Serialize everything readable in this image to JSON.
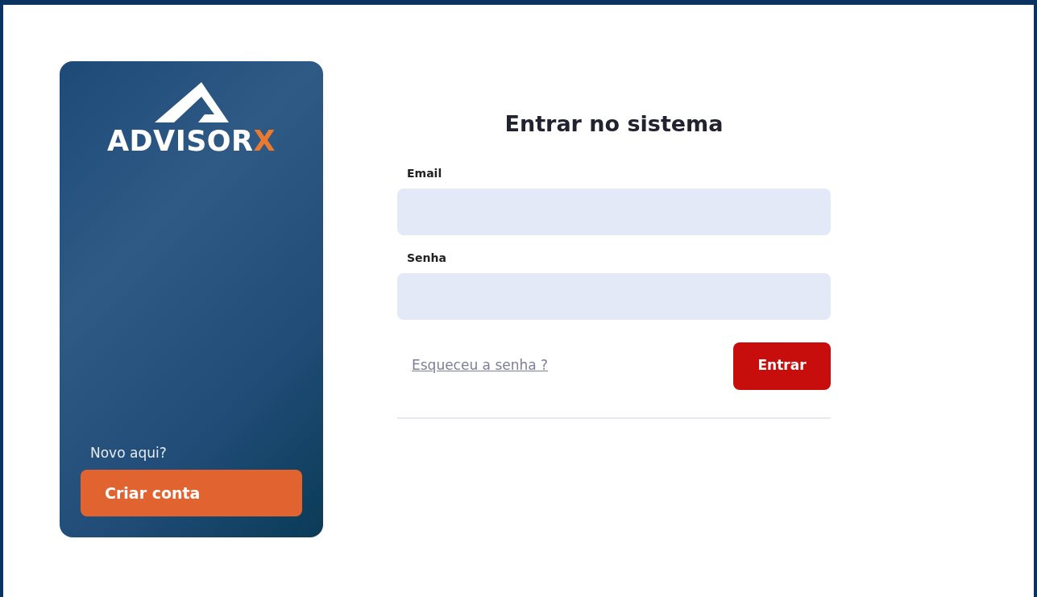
{
  "brand": {
    "name": "ADVISOR",
    "accent": "X"
  },
  "signup": {
    "prompt": "Novo aqui?",
    "button": "Criar conta"
  },
  "login": {
    "title": "Entrar no sistema",
    "fields": [
      {
        "label": "Email"
      },
      {
        "label": "Senha"
      }
    ],
    "forgot_link": "Esqueceu a senha ?",
    "submit": "Entrar"
  }
}
